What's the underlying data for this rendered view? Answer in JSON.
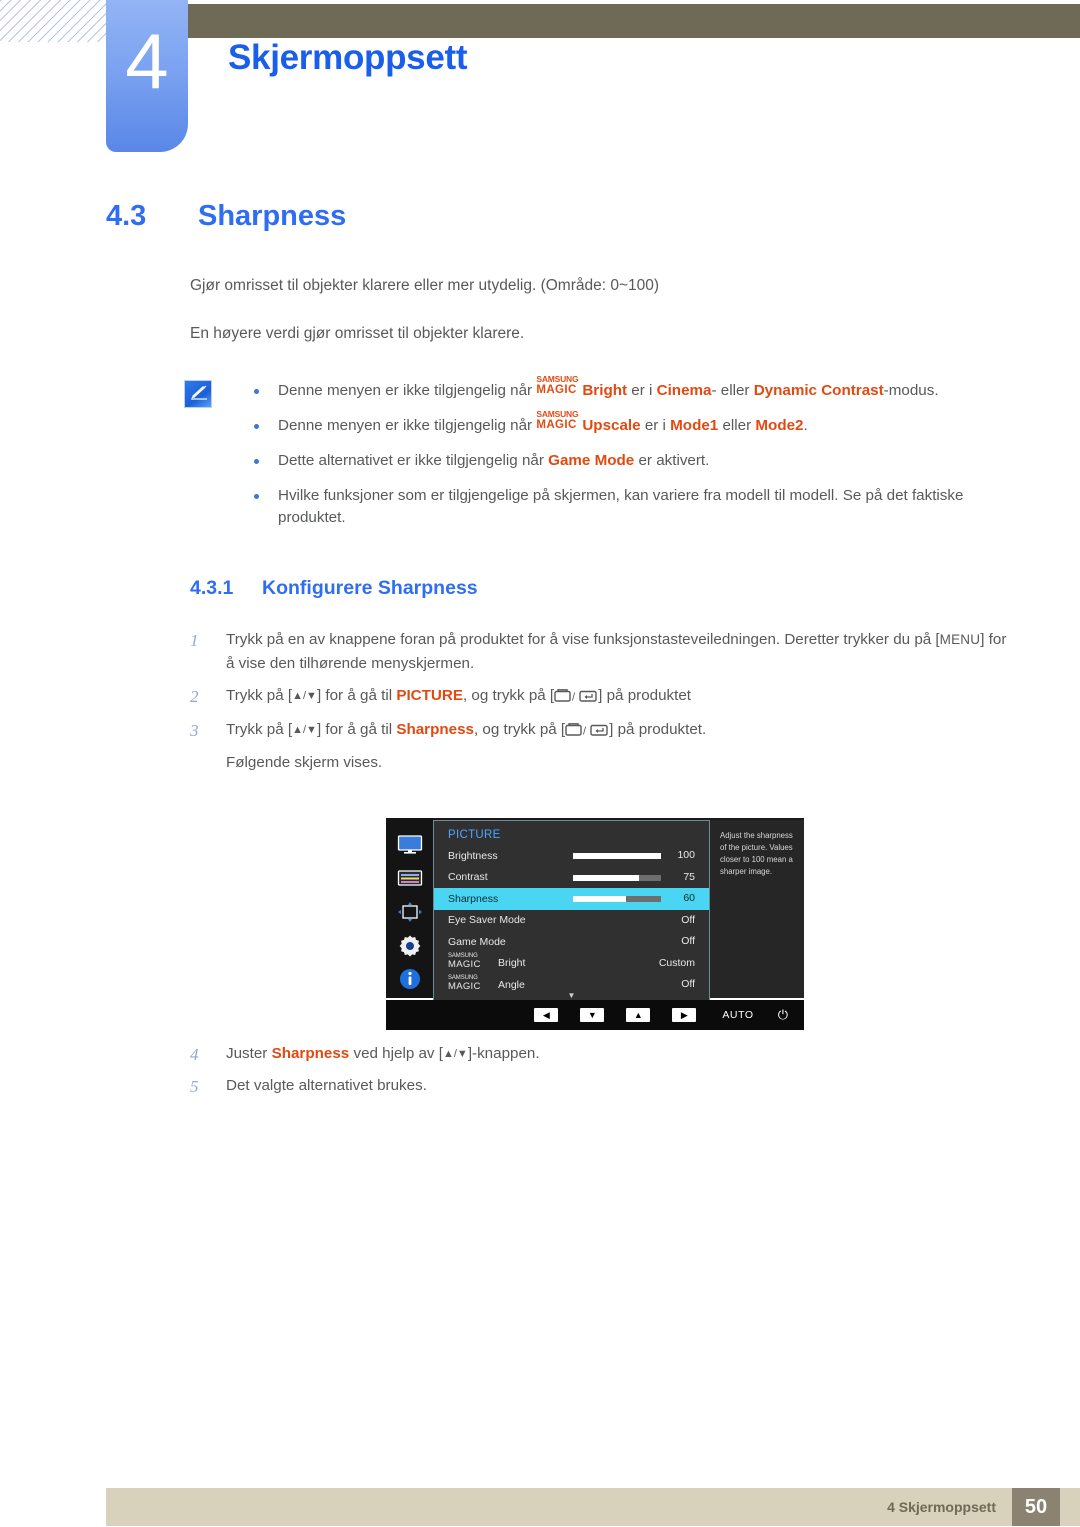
{
  "header": {
    "chapter_number": "4",
    "chapter_title": "Skjermoppsett"
  },
  "section": {
    "number": "4.3",
    "title": "Sharpness",
    "intro_1": "Gjør omrisset til objekter klarere eller mer utydelig. (Område: 0~100)",
    "intro_2": "En høyere verdi gjør omrisset til objekter klarere."
  },
  "note": {
    "icon": "note-pen-icon",
    "bullets": [
      {
        "pre": "Denne menyen er ikke tilgjengelig når ",
        "magic_top": "SAMSUNG",
        "magic_bottom": "MAGIC",
        "magic_suffix": "Bright",
        "mid": " er i ",
        "hl1": "Cinema",
        "mid2": "- eller ",
        "hl2": "Dynamic Contrast",
        "post": "-modus."
      },
      {
        "pre": "Denne menyen er ikke tilgjengelig når ",
        "magic_top": "SAMSUNG",
        "magic_bottom": "MAGIC",
        "magic_suffix": "Upscale",
        "mid": " er i ",
        "hl1": "Mode1",
        "mid2": " eller ",
        "hl2": "Mode2",
        "post": "."
      },
      {
        "pre": "Dette alternativet er ikke tilgjengelig når ",
        "hl1": "Game Mode",
        "post": " er aktivert."
      },
      {
        "pre": "Hvilke funksjoner som er tilgjengelige på skjermen, kan variere fra modell til modell. Se på det faktiske produktet."
      }
    ]
  },
  "subsection": {
    "number": "4.3.1",
    "title": "Konfigurere Sharpness"
  },
  "steps": [
    {
      "num": "1",
      "part1": "Trykk på en av knappene foran på produktet for å vise funksjonstasteveiledningen. Deretter trykker du på [",
      "key": "MENU",
      "part2": "] for å vise den tilhørende menyskjermen."
    },
    {
      "num": "2",
      "part1": "Trykk på [",
      "arrows": "▲/▼",
      "part2": "] for å gå til ",
      "hl": "PICTURE",
      "part3": ", og trykk på [",
      "part4": "] på produktet"
    },
    {
      "num": "3",
      "part1": "Trykk på [",
      "arrows": "▲/▼",
      "part2": "] for å gå til ",
      "hl": "Sharpness",
      "part3": ", og trykk på [",
      "part4": "] på produktet.",
      "part5": "Følgende skjerm vises."
    },
    {
      "num": "4",
      "part1": "Juster ",
      "hl": "Sharpness",
      "part2": " ved hjelp av [",
      "arrows": "▲/▼",
      "part3": "]-knappen."
    },
    {
      "num": "5",
      "part1": "Det valgte alternativet brukes."
    }
  ],
  "osd": {
    "menu_title": "PICTURE",
    "sidebar_icons": [
      "monitor-icon",
      "picture-list-icon",
      "screen-adjust-icon",
      "gear-icon",
      "info-icon"
    ],
    "rows": [
      {
        "label": "Brightness",
        "value": "100",
        "bar": 100,
        "selected": false,
        "has_bar": true
      },
      {
        "label": "Contrast",
        "value": "75",
        "bar": 75,
        "selected": false,
        "has_bar": true
      },
      {
        "label": "Sharpness",
        "value": "60",
        "bar": 60,
        "selected": true,
        "has_bar": true
      },
      {
        "label": "Eye Saver Mode",
        "value": "Off",
        "selected": false,
        "has_bar": false
      },
      {
        "label": "Game Mode",
        "value": "Off",
        "selected": false,
        "has_bar": false
      },
      {
        "label_magic_top": "SAMSUNG",
        "label_magic_bottom": "MAGIC",
        "label": "Bright",
        "value": "Custom",
        "selected": false,
        "has_bar": false,
        "is_magic": true
      },
      {
        "label_magic_top": "SAMSUNG",
        "label_magic_bottom": "MAGIC",
        "label": "Angle",
        "value": "Off",
        "selected": false,
        "has_bar": false,
        "is_magic": true
      }
    ],
    "scroll_caret": "▼",
    "help_text": "Adjust the sharpness of the picture. Values closer to 100 mean a sharper image.",
    "buttons": [
      "◀",
      "▼",
      "▲",
      "▶"
    ],
    "auto_label": "AUTO",
    "power_glyph": "⏻"
  },
  "footer": {
    "text": "4 Skjermoppsett",
    "page": "50"
  },
  "colors": {
    "heading_blue": "#2f6df5",
    "chapter_blue": "#1a5eea",
    "highlight_orange": "#e24a12",
    "band_olive": "#6e6a56",
    "footer_bg": "#d8d2bd",
    "footer_page_bg": "#8c8272",
    "osd_selected": "#4ad5f2",
    "osd_title_blue": "#4da6ff"
  }
}
